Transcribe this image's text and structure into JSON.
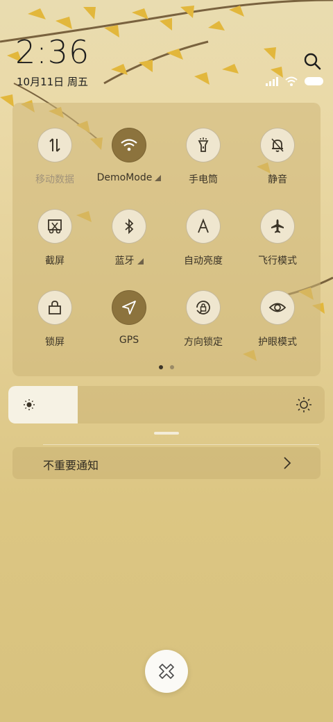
{
  "status_bar": {
    "time": "2:36",
    "date": "10月11日 周五"
  },
  "quick_settings": {
    "tiles": [
      {
        "label": "移动数据",
        "icon": "mobile-data-icon",
        "state": "disabled"
      },
      {
        "label": "DemoMode",
        "icon": "wifi-icon",
        "state": "on"
      },
      {
        "label": "手电筒",
        "icon": "flashlight-icon",
        "state": "off"
      },
      {
        "label": "静音",
        "icon": "mute-bell-icon",
        "state": "off"
      },
      {
        "label": "截屏",
        "icon": "screenshot-icon",
        "state": "off"
      },
      {
        "label": "蓝牙",
        "icon": "bluetooth-icon",
        "state": "off"
      },
      {
        "label": "自动亮度",
        "icon": "auto-brightness-icon",
        "state": "off"
      },
      {
        "label": "飞行模式",
        "icon": "airplane-icon",
        "state": "off"
      },
      {
        "label": "锁屏",
        "icon": "lock-icon",
        "state": "off"
      },
      {
        "label": "GPS",
        "icon": "location-icon",
        "state": "on"
      },
      {
        "label": "方向锁定",
        "icon": "rotation-lock-icon",
        "state": "off"
      },
      {
        "label": "护眼模式",
        "icon": "eye-icon",
        "state": "off"
      }
    ],
    "page_count": 2,
    "current_page": 1
  },
  "brightness": {
    "level": 0.22
  },
  "notifications": {
    "unimportant_label": "不重要通知"
  },
  "colors": {
    "tile_active": "#8c733d",
    "tile_inactive": "#efe6cf"
  }
}
